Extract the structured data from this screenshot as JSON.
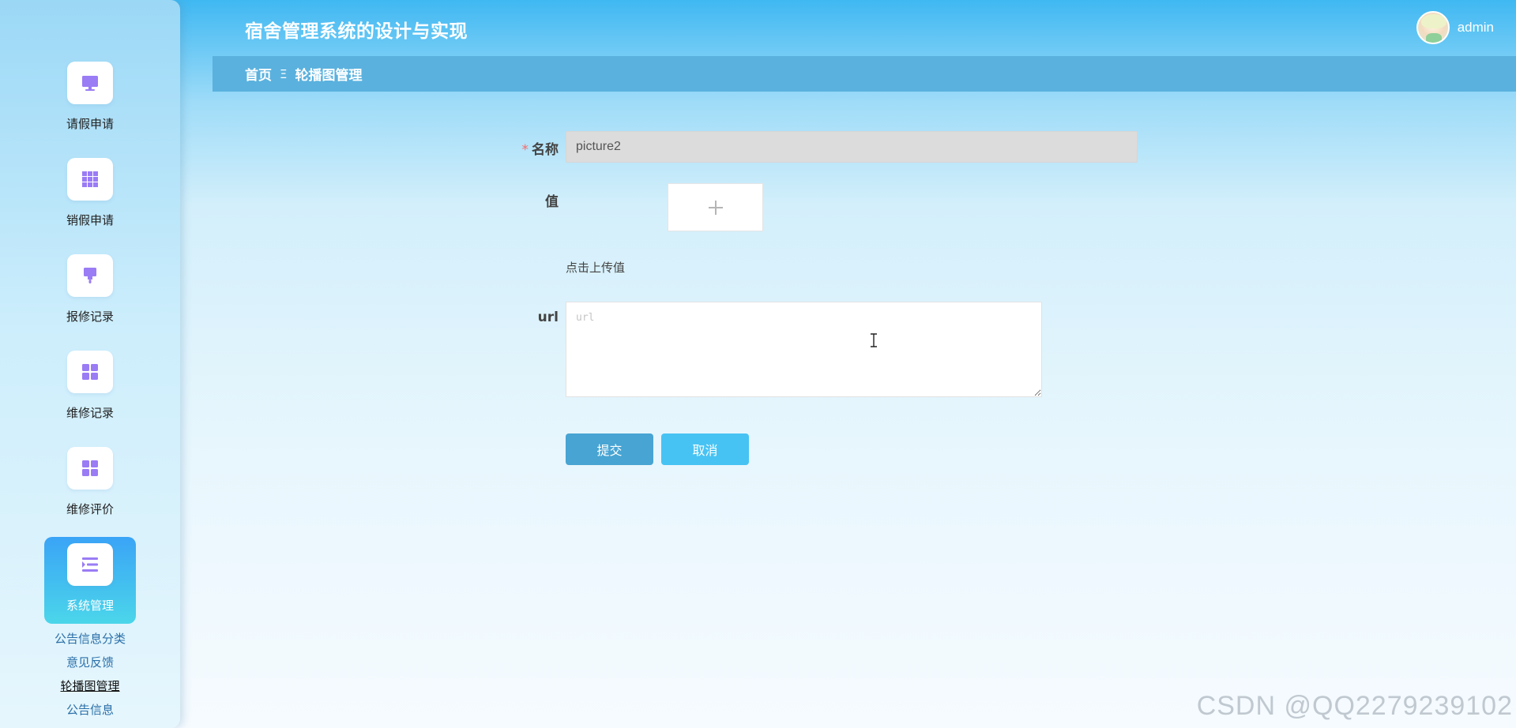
{
  "app_title": "宿舍管理系统的设计与实现",
  "user": {
    "name": "admin"
  },
  "breadcrumb": {
    "home": "首页",
    "separator": "Ξ",
    "current": "轮播图管理"
  },
  "sidebar": {
    "items": [
      {
        "label": "请假申请",
        "icon": "monitor-icon"
      },
      {
        "label": "销假申请",
        "icon": "grid-icon"
      },
      {
        "label": "报修记录",
        "icon": "brush-icon"
      },
      {
        "label": "维修记录",
        "icon": "apps-icon"
      },
      {
        "label": "维修评价",
        "icon": "apps-icon"
      },
      {
        "label": "系统管理",
        "icon": "menu-list-icon",
        "active": true
      }
    ],
    "submenu": [
      {
        "label": "公告信息分类"
      },
      {
        "label": "意见反馈"
      },
      {
        "label": "轮播图管理",
        "current": true
      },
      {
        "label": "公告信息"
      }
    ]
  },
  "form": {
    "name_label": "名称",
    "name_required_mark": "*",
    "name_value": "picture2",
    "value_label": "值",
    "upload_hint": "点击上传值",
    "url_label": "url",
    "url_placeholder": "url",
    "submit_label": "提交",
    "cancel_label": "取消"
  },
  "watermark": "CSDN @QQ2279239102",
  "colors": {
    "header": "#4fbaf0",
    "breadcrumb_bar": "#5ab1de",
    "submit_button": "#47a4d3",
    "cancel_button": "#47c3f3",
    "icon_purple": "#9a7cf5",
    "active_menu": "#3aa4f6"
  }
}
